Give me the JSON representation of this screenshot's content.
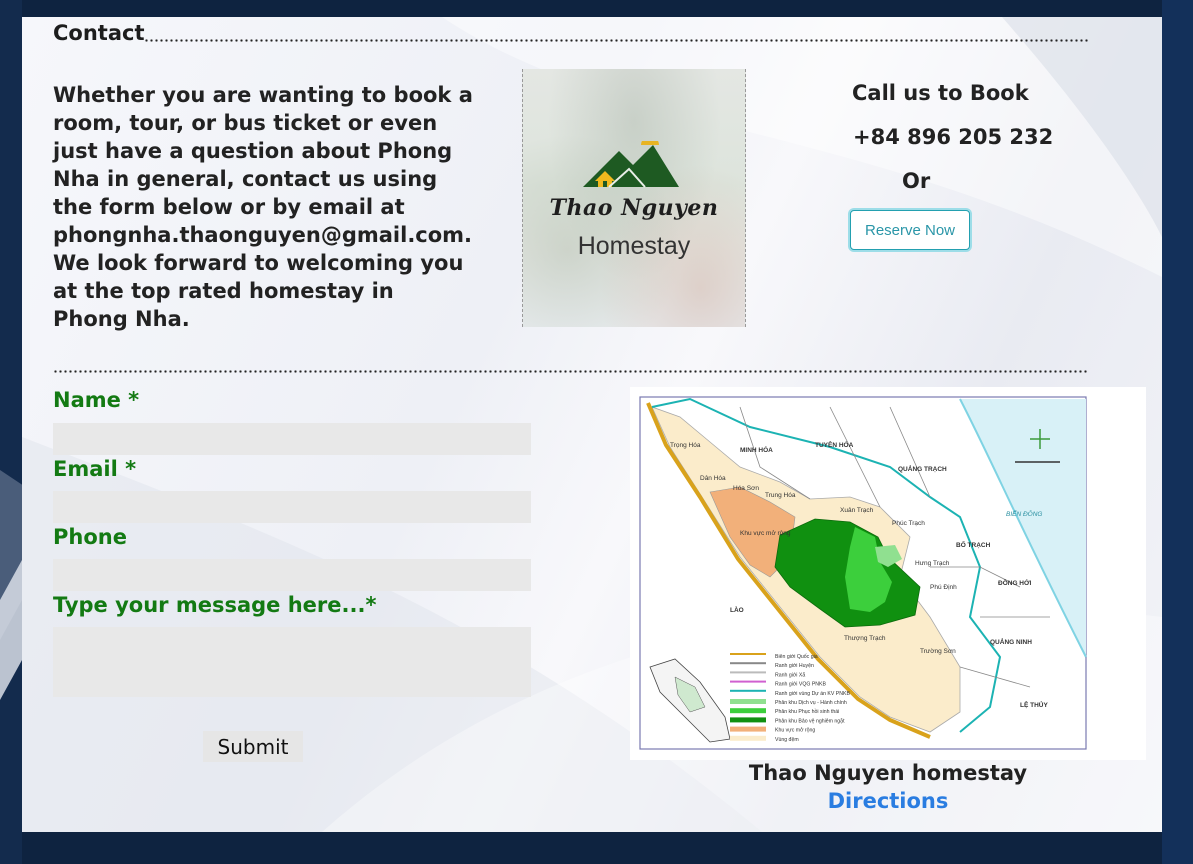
{
  "contact": {
    "heading": "Contact",
    "intro": "Whether you are wanting to book a room, tour, or bus ticket or even just have a question about Phong Nha in general, contact us using the form below or by email at phongnha.thaonguyen@gmail.com. We look forward to welcoming you at the top rated homestay in Phong Nha."
  },
  "logo": {
    "script_text": "Thao Nguyen",
    "sub_text": "Homestay"
  },
  "booking": {
    "call_title": "Call us to Book",
    "phone": "+84 896 205 232",
    "or_text": "Or",
    "reserve_label": "Reserve Now"
  },
  "form": {
    "name_label": "Name *",
    "email_label": "Email *",
    "phone_label": "Phone",
    "message_label": "Type your message here...*",
    "name_value": "",
    "email_value": "",
    "phone_value": "",
    "message_value": "",
    "submit_label": "Submit"
  },
  "map": {
    "labels": {
      "trong_hoa": "Trọng Hóa",
      "minh_hoa": "MINH HÓA",
      "tuyen_hoa": "TUYÊN HÓA",
      "quang_trach": "QUẢNG TRẠCH",
      "dan_hoa": "Dân Hóa",
      "hoa_son": "Hóa Sơn",
      "trung_hoa": "Trung Hóa",
      "xuan_trach": "Xuân Trạch",
      "phuc_trach": "Phúc Trạch",
      "bien_dong": "BIỂN ĐÔNG",
      "khu_vuc_mo_rong": "Khu vực mở rộng",
      "bo_trach": "BỐ TRẠCH",
      "hung_trach": "Hưng Trạch",
      "dong_hoi": "ĐỒNG HỚI",
      "lao": "LÀO",
      "phu_dinh": "Phú Định",
      "quang_ninh": "QUẢNG NINH",
      "thuong_trach": "Thượng Trạch",
      "truong_son": "Trường Sơn",
      "le_thuy": "LỆ THỦY"
    },
    "legend": [
      {
        "label": "Biên giới Quốc gia",
        "color": "#d9a21b"
      },
      {
        "label": "Ranh giới Huyện",
        "color": "#888888"
      },
      {
        "label": "Ranh giới Xã",
        "color": "#bbbbbb"
      },
      {
        "label": "Ranh giới VQG PNKB",
        "color": "#d060d0"
      },
      {
        "label": "Ranh giới vùng Dự án KV PNKB",
        "color": "#1cb3b3"
      },
      {
        "label": "Phân khu Dịch vụ - Hành chính",
        "color": "#90e090"
      },
      {
        "label": "Phân khu Phục hồi sinh thái",
        "color": "#3ccf3c"
      },
      {
        "label": "Phân khu Bảo vệ nghiêm ngặt",
        "color": "#109010"
      },
      {
        "label": "Khu vực mở rộng",
        "color": "#f2b07a"
      },
      {
        "label": "Vùng đệm",
        "color": "#fbeccb"
      }
    ],
    "caption": "Thao Nguyen homestay",
    "directions_label": "Directions"
  },
  "colors": {
    "label_green": "#137a13",
    "link_blue": "#2a7de1",
    "reserve_teal": "#2a96a8",
    "background_navy": "#0e2340"
  }
}
